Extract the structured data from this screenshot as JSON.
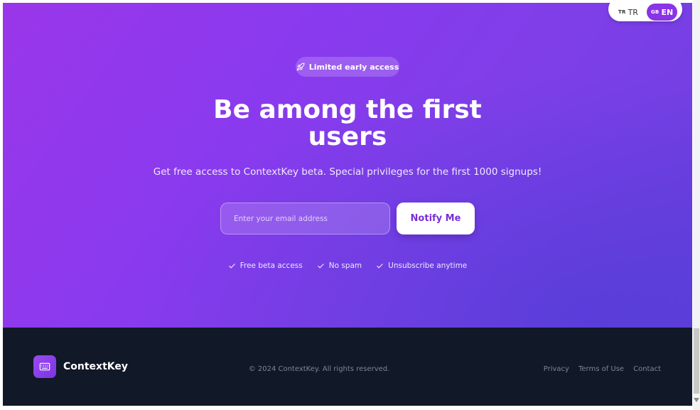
{
  "language_switch": {
    "options": [
      {
        "flag_code": "TR",
        "label": "TR"
      },
      {
        "flag_code": "GB",
        "label": "EN"
      }
    ],
    "active": "EN"
  },
  "hero": {
    "badge": "Limited early access",
    "badge_icon": "rocket-icon",
    "title": "Be among the first users",
    "subtitle": "Get free access to ContextKey beta. Special privileges for the first 1000 signups!",
    "email_placeholder": "Enter your email address",
    "email_value": "",
    "notify_label": "Notify Me",
    "features": [
      "Free beta access",
      "No spam",
      "Unsubscribe anytime"
    ]
  },
  "footer": {
    "brand": "ContextKey",
    "brand_icon": "keyboard-icon",
    "copyright": "© 2024 ContextKey. All rights reserved.",
    "links": [
      "Privacy",
      "Terms of Use",
      "Contact"
    ]
  },
  "colors": {
    "hero_gradient_start": "#9a36ea",
    "hero_gradient_end": "#6a3fde",
    "footer_bg": "#111827",
    "accent": "#7a2fd8"
  }
}
